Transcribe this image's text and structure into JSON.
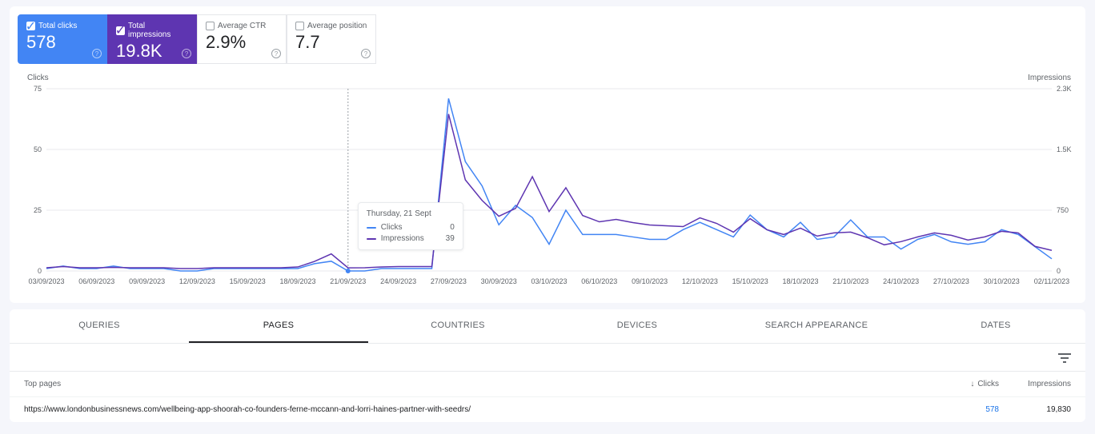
{
  "metrics": {
    "clicks": {
      "label": "Total clicks",
      "value": "578"
    },
    "impr": {
      "label": "Total impressions",
      "value": "19.8K"
    },
    "ctr": {
      "label": "Average CTR",
      "value": "2.9%"
    },
    "position": {
      "label": "Average position",
      "value": "7.7"
    }
  },
  "axis": {
    "left_title": "Clicks",
    "right_title": "Impressions"
  },
  "tooltip": {
    "title": "Thursday, 21 Sept",
    "clicks_label": "Clicks",
    "clicks_value": "0",
    "impr_label": "Impressions",
    "impr_value": "39"
  },
  "tabs": [
    "QUERIES",
    "PAGES",
    "COUNTRIES",
    "DEVICES",
    "SEARCH APPEARANCE",
    "DATES"
  ],
  "table": {
    "page_header": "Top pages",
    "clicks_header": "Clicks",
    "impr_header": "Impressions",
    "row": {
      "url": "https://www.londonbusinessnews.com/wellbeing-app-shoorah-co-founders-ferne-mccann-and-lorri-haines-partner-with-seedrs/",
      "clicks": "578",
      "impr": "19,830"
    }
  },
  "chart_data": {
    "type": "line",
    "xlabel": "",
    "ylabel_left": "Clicks",
    "ylabel_right": "Impressions",
    "ylim_left": [
      0,
      75
    ],
    "ylim_right": [
      0,
      2300
    ],
    "left_ticks": [
      0,
      25,
      50,
      75
    ],
    "right_ticks": [
      0,
      750,
      1500,
      2300
    ],
    "x_ticks": [
      "03/09/2023",
      "06/09/2023",
      "09/09/2023",
      "12/09/2023",
      "15/09/2023",
      "18/09/2023",
      "21/09/2023",
      "24/09/2023",
      "27/09/2023",
      "30/09/2023",
      "03/10/2023",
      "06/10/2023",
      "09/10/2023",
      "12/10/2023",
      "15/10/2023",
      "18/10/2023",
      "21/10/2023",
      "24/10/2023",
      "27/10/2023",
      "30/10/2023",
      "02/11/2023"
    ],
    "dates": [
      "03/09",
      "04/09",
      "05/09",
      "06/09",
      "07/09",
      "08/09",
      "09/09",
      "10/09",
      "11/09",
      "12/09",
      "13/09",
      "14/09",
      "15/09",
      "16/09",
      "17/09",
      "18/09",
      "19/09",
      "20/09",
      "21/09",
      "22/09",
      "23/09",
      "24/09",
      "25/09",
      "26/09",
      "27/09",
      "28/09",
      "29/09",
      "30/09",
      "01/10",
      "02/10",
      "03/10",
      "04/10",
      "05/10",
      "06/10",
      "07/10",
      "08/10",
      "09/10",
      "10/10",
      "11/10",
      "12/10",
      "13/10",
      "14/10",
      "15/10",
      "16/10",
      "17/10",
      "18/10",
      "19/10",
      "20/10",
      "21/10",
      "22/10",
      "23/10",
      "24/10",
      "25/10",
      "26/10",
      "27/10",
      "28/10",
      "29/10",
      "30/10",
      "31/10",
      "01/11",
      "02/11"
    ],
    "series": [
      {
        "name": "Clicks",
        "color": "#4285f4",
        "axis": "left",
        "values": [
          1,
          2,
          1,
          1,
          2,
          1,
          1,
          1,
          0,
          0,
          1,
          1,
          1,
          1,
          1,
          1,
          3,
          4,
          0,
          0,
          1,
          1,
          1,
          1,
          71,
          45,
          35,
          19,
          27,
          22,
          11,
          25,
          15,
          15,
          15,
          14,
          13,
          13,
          17,
          20,
          17,
          14,
          23,
          17,
          14,
          20,
          13,
          14,
          21,
          14,
          14,
          9,
          13,
          15,
          12,
          11,
          12,
          17,
          15,
          10,
          5
        ]
      },
      {
        "name": "Impressions",
        "color": "#5e35b1",
        "axis": "right",
        "values": [
          40,
          55,
          40,
          40,
          45,
          40,
          40,
          40,
          30,
          30,
          40,
          40,
          40,
          40,
          40,
          50,
          120,
          215,
          39,
          40,
          50,
          55,
          55,
          55,
          1980,
          1150,
          890,
          690,
          790,
          1190,
          750,
          1050,
          700,
          620,
          650,
          610,
          580,
          570,
          560,
          670,
          600,
          490,
          660,
          520,
          460,
          540,
          440,
          480,
          490,
          420,
          330,
          370,
          430,
          480,
          450,
          390,
          430,
          500,
          480,
          310,
          260
        ]
      }
    ],
    "highlight_index": 18
  }
}
